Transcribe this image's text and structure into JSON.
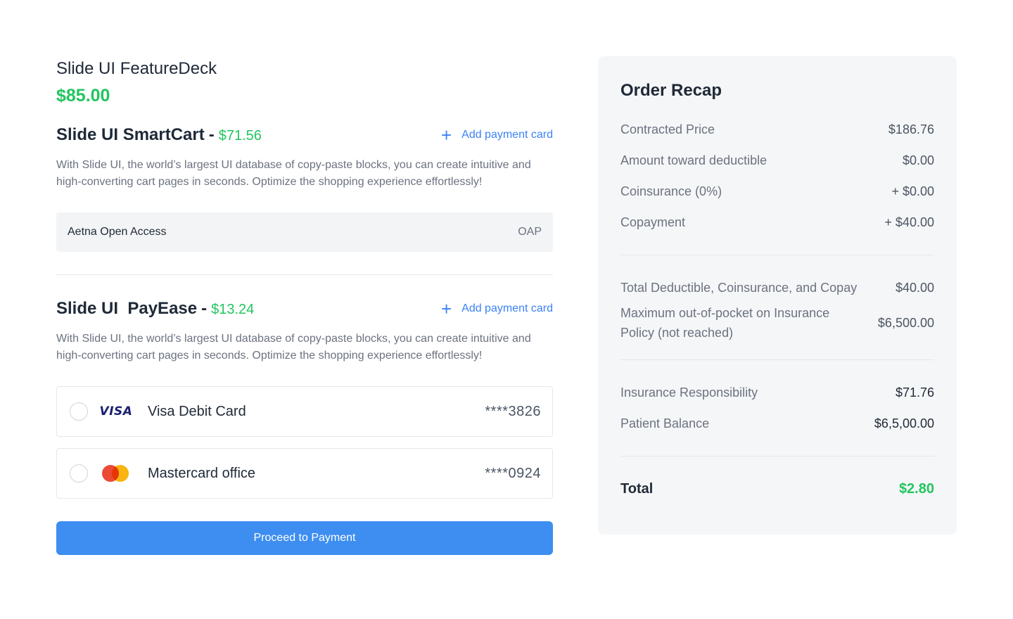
{
  "product": {
    "title": "Slide UI FeatureDeck",
    "price": "$85.00"
  },
  "sections": [
    {
      "name": "Slide UI SmartCart",
      "separator": "-",
      "price": "$71.56",
      "add_card_label": "Add payment card",
      "description": "With Slide UI, the world’s largest UI database of copy-paste blocks, you can create intuitive and high-converting cart pages in seconds. Optimize the shopping experience effortlessly!",
      "plan": {
        "name": "Aetna Open Access",
        "code": "OAP"
      }
    },
    {
      "name": "Slide UI  PayEase",
      "separator": "-",
      "price": "$13.24",
      "add_card_label": "Add payment card",
      "description": "With Slide UI, the world’s largest UI database of copy-paste blocks, you can create intuitive and high-converting cart pages in seconds. Optimize the shopping experience effortlessly!"
    }
  ],
  "payment_cards": [
    {
      "brand": "VISA",
      "icon": "visa-logo",
      "name": "Visa Debit Card",
      "masked": "****3826"
    },
    {
      "brand": "Mastercard",
      "icon": "mastercard-logo",
      "name": "Mastercard office",
      "masked": "****0924"
    }
  ],
  "proceed_label": "Proceed to Payment",
  "recap": {
    "title": "Order Recap",
    "group1": [
      {
        "label": "Contracted Price",
        "value": "$186.76"
      },
      {
        "label": "Amount toward deductible",
        "value": "$0.00"
      },
      {
        "label": "Coinsurance (0%)",
        "value": "+ $0.00"
      },
      {
        "label": "Copayment",
        "value": "+ $40.00"
      }
    ],
    "group2": [
      {
        "label": "Total Deductible, Coinsurance, and Copay",
        "value": "$40.00"
      },
      {
        "label": "Maximum out-of-pocket on Insurance Policy (not reached)",
        "value": "$6,500.00"
      }
    ],
    "group3": [
      {
        "label": "Insurance Responsibility",
        "value": "$71.76"
      },
      {
        "label": "Patient Balance",
        "value": "$6,5,00.00"
      }
    ],
    "total": {
      "label": "Total",
      "value": "$2.80"
    }
  },
  "colors": {
    "accent": "#3b82f6",
    "button": "#3d8ef0",
    "green": "#22c55e",
    "panel": "#f5f6f7"
  }
}
